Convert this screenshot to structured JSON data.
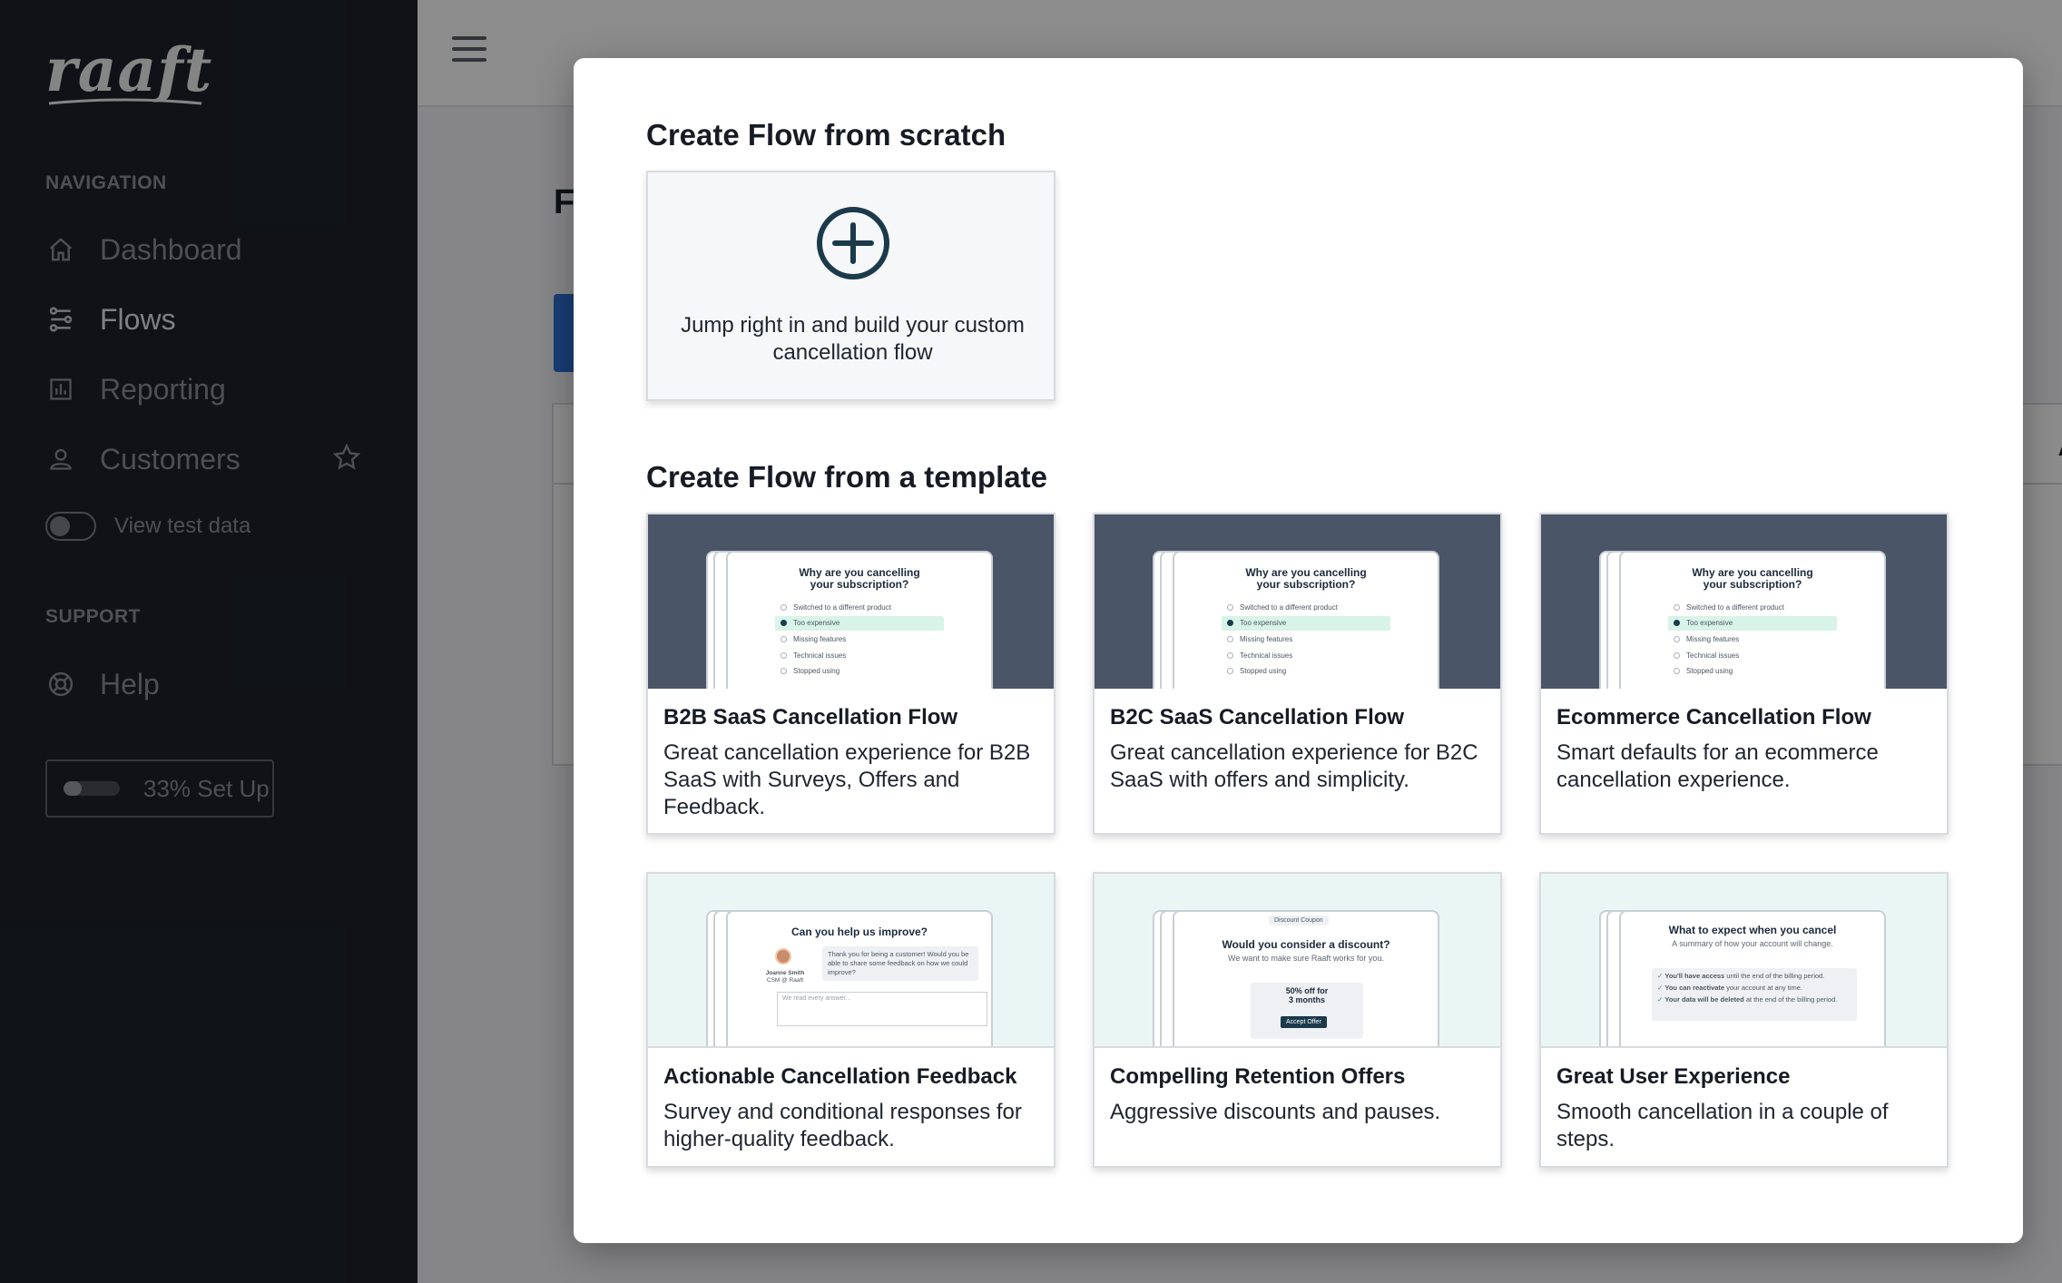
{
  "sidebar": {
    "logo": "raaft",
    "navigation_label": "NAVIGATION",
    "nav": [
      {
        "label": "Dashboard",
        "icon": "home-icon"
      },
      {
        "label": "Flows",
        "icon": "flows-icon"
      },
      {
        "label": "Reporting",
        "icon": "chart-icon"
      },
      {
        "label": "Customers",
        "icon": "user-icon"
      }
    ],
    "toggle_label": "View test data",
    "support_label": "SUPPORT",
    "help_label": "Help",
    "setup_label": "33% Set Up",
    "setup_progress": 0.33
  },
  "background": {
    "page_title_initial": "F",
    "column_partial": "Ac"
  },
  "modal": {
    "scratch_heading": "Create Flow from scratch",
    "scratch_text": "Jump right in and build your custom cancellation flow",
    "template_heading": "Create Flow from a template",
    "templates": [
      {
        "title": "B2B SaaS Cancellation Flow",
        "desc": "Great cancellation experience for B2B SaaS with Surveys, Offers and Feedback."
      },
      {
        "title": "B2C SaaS Cancellation Flow",
        "desc": "Great cancellation experience for B2C SaaS with offers and simplicity."
      },
      {
        "title": "Ecommerce Cancellation Flow",
        "desc": "Smart defaults for an ecommerce cancellation experience."
      },
      {
        "title": "Actionable Cancellation Feedback",
        "desc": "Survey and conditional responses for higher-quality feedback."
      },
      {
        "title": "Compelling Retention Offers",
        "desc": "Aggressive discounts and pauses."
      },
      {
        "title": "Great User Experience",
        "desc": "Smooth cancellation in a couple of steps."
      }
    ]
  },
  "previews": {
    "survey": {
      "title": "Why are you cancelling your subscription?",
      "options": [
        "Switched to a different product",
        "Too expensive",
        "Missing features",
        "Technical issues",
        "Stopped using"
      ]
    },
    "feedback": {
      "title": "Can you help us improve?",
      "message": "Thank you for being a customer! Would you be able to share some feedback on how we could improve?",
      "person_name": "Joanne Smith",
      "person_role": "CSM @ Raaft",
      "placeholder": "We read every answer..."
    },
    "offer": {
      "badge": "Discount Coupon",
      "title": "Would you consider a discount?",
      "subtitle": "We want to make sure Raaft works for you.",
      "offer_line1": "50% off for",
      "offer_line2": "3 months",
      "button": "Accept Offer"
    },
    "expect": {
      "title": "What to expect when you cancel",
      "subtitle": "A summary of how your account will change.",
      "items": [
        {
          "bold": "You'll have access",
          "rest": " until the end of the billing period."
        },
        {
          "bold": "You can reactivate",
          "rest": " your account at any time."
        },
        {
          "bold": "Your data will be deleted",
          "rest": " at the end of the billing period."
        }
      ]
    }
  },
  "colors": {
    "sidebar_bg": "#1e222a",
    "preview_dark": "#4a5567",
    "preview_mint": "#e9f6f3",
    "accent_navy": "#1b3a4b"
  }
}
